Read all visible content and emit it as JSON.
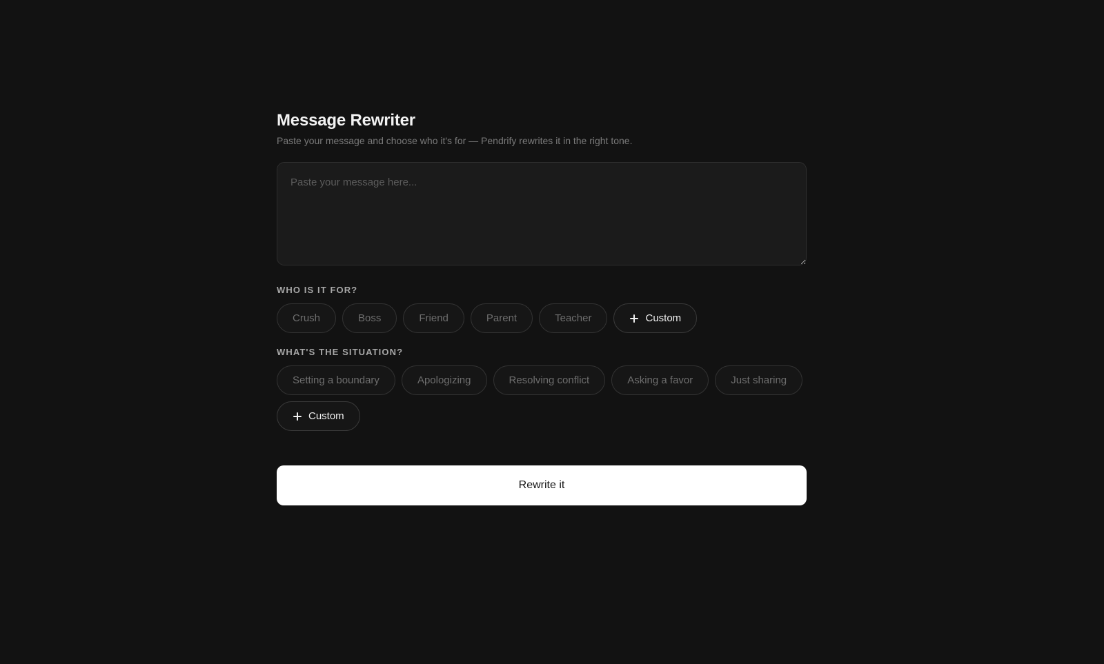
{
  "header": {
    "title": "Message Rewriter",
    "subtitle": "Paste your message and choose who it's for — Pendrify rewrites it in the right tone."
  },
  "message": {
    "value": "",
    "placeholder": "Paste your message here..."
  },
  "recipient": {
    "label": "WHO IS IT FOR?",
    "options": [
      "Crush",
      "Boss",
      "Friend",
      "Parent",
      "Teacher"
    ],
    "custom_label": "Custom"
  },
  "situation": {
    "label": "WHAT'S THE SITUATION?",
    "options": [
      "Setting a boundary",
      "Apologizing",
      "Resolving conflict",
      "Asking a favor",
      "Just sharing"
    ],
    "custom_label": "Custom"
  },
  "actions": {
    "rewrite_label": "Rewrite it"
  },
  "icons": {
    "custom": "plus-icon"
  },
  "colors": {
    "background": "#121212",
    "primary_button": "#ffffff"
  }
}
